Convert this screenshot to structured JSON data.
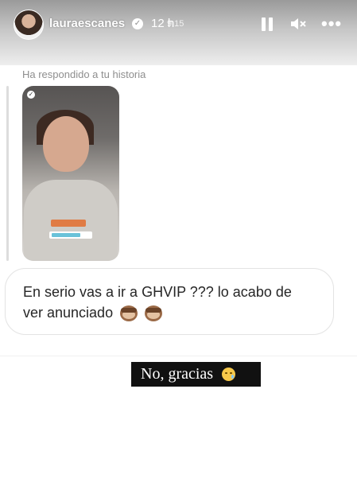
{
  "header": {
    "username": "lauraescanes",
    "time": "12 h",
    "clock_overlay": "9:15",
    "verified_glyph": "✓",
    "more_glyph": "•••",
    "icons": [
      "avatar",
      "verified-badge-icon",
      "pause-icon",
      "mute-icon",
      "more-icon"
    ]
  },
  "reply": {
    "caption": "Ha respondido a tu historia"
  },
  "story_preview": {
    "caption_lines": ""
  },
  "message": {
    "text_line1": "En serio vas a ir a GHVIP ??? lo acabo de",
    "text_line2": "ver anunciado",
    "emojis": [
      "see-no-evil-monkey-icon",
      "see-no-evil-monkey-icon"
    ]
  },
  "sticker": {
    "text": "No, gracias",
    "emoji": "crying-face-icon",
    "background": "#111111",
    "color": "#ffffff"
  },
  "colors": {
    "caption": "#8e8e8e",
    "message_text": "#262626",
    "bubble_border": "#e4e4e4"
  }
}
